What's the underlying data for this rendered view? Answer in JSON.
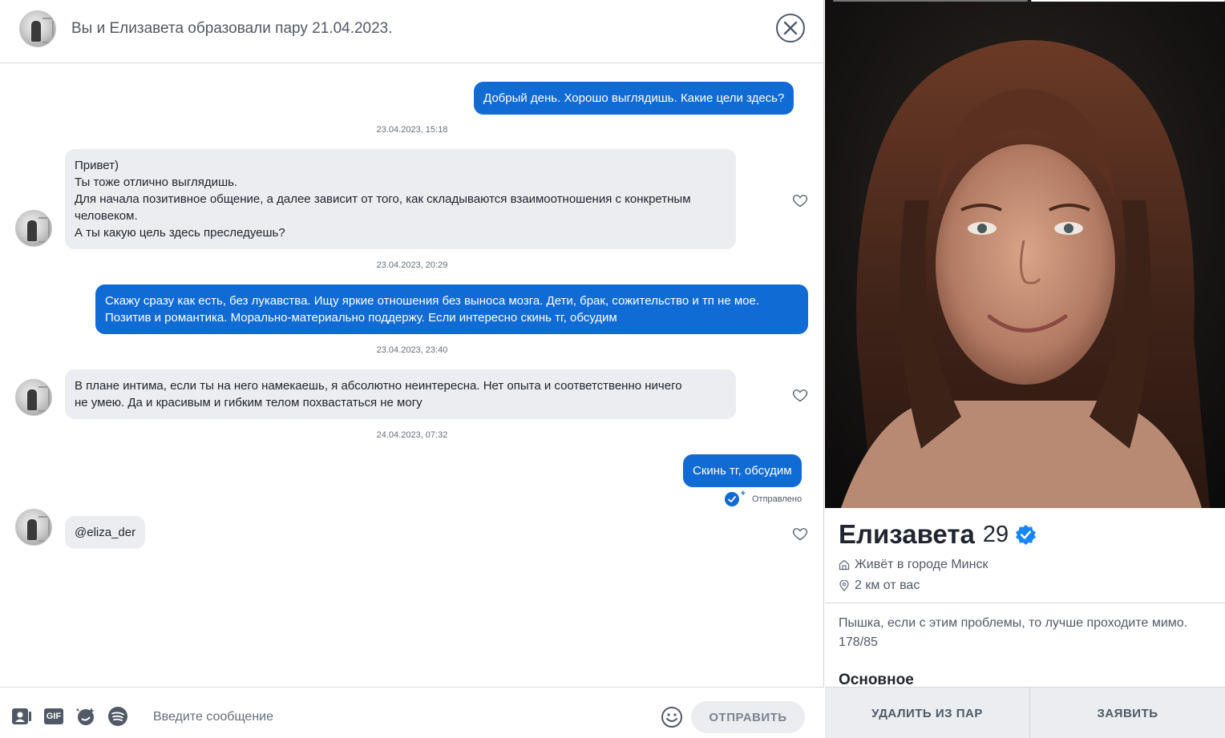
{
  "header": {
    "title": "Вы и Елизавета образовали пару 21.04.2023."
  },
  "messages": [
    {
      "side": "sent",
      "lines": [
        "Добрый день. Хорошо выглядишь. Какие цели здесь?"
      ]
    },
    {
      "side": "received",
      "timestamp": "23.04.2023, 15:18",
      "lines": [
        "Привет)",
        "Ты тоже отлично выглядишь.",
        "Для начала позитивное общение, а далее зависит от того, как складываются взаимоотношения с конкретным",
        "человеком.",
        "А ты какую цель здесь преследуешь?"
      ]
    },
    {
      "side": "sent",
      "timestamp": "23.04.2023, 20:29",
      "lines": [
        "Скажу сразу как есть, без лукавства. Ищу яркие отношения без выноса мозга. Дети, брак, сожительство и тп не мое.",
        "Позитив и романтика. Морально-материально поддержу. Если интересно скинь тг, обсудим"
      ]
    },
    {
      "side": "received",
      "timestamp": "23.04.2023, 23:40",
      "lines": [
        "В плане интима, если ты на него намекаешь, я абсолютно неинтересна. Нет опыта и соответственно ничего",
        "не умею. Да и красивым и гибким телом похвастаться не могу"
      ]
    },
    {
      "side": "sent",
      "timestamp": "24.04.2023, 07:32",
      "lines": [
        "Скинь тг, обсудим"
      ],
      "status": "Отправлено"
    },
    {
      "side": "received",
      "lines": [
        "@eliza_der"
      ]
    }
  ],
  "composer": {
    "tools": [
      "contact-card-icon",
      "gif-icon",
      "sticker-icon",
      "spotify-icon"
    ],
    "gif_label": "GIF",
    "placeholder": "Введите сообщение",
    "send_label": "ОТПРАВИТЬ"
  },
  "profile": {
    "name": "Елизавета",
    "age": "29",
    "verified": true,
    "lives_in": "Живёт в городе Минск",
    "distance": "2 км от вас",
    "bio_line1": "Пышка, если с этим проблемы, то лучше проходите мимо.",
    "bio_line2": "178/85",
    "section_title": "Основное",
    "photo_count": 2,
    "photo_active": 2,
    "unmatch_label": "УДАЛИТЬ ИЗ ПАР",
    "report_label": "ЗАЯВИТЬ"
  },
  "colors": {
    "sent_bubble": "#106bd5",
    "received_bubble": "#ebedf0",
    "text_secondary": "#505965",
    "verified_blue": "#1786f8"
  }
}
